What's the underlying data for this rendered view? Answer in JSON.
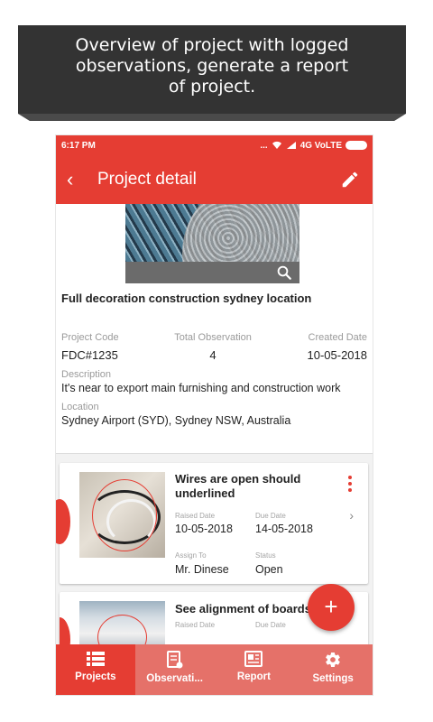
{
  "banner": {
    "line1": "Overview of project with logged",
    "line2": "observations, generate a report",
    "line3": "of project."
  },
  "status_bar": {
    "time": "6:17 PM",
    "indicators": "... ",
    "network": "4G VoLTE"
  },
  "app_bar": {
    "title": "Project detail",
    "back_icon": "chevron-left-icon",
    "edit_icon": "pencil-icon"
  },
  "project": {
    "name": "Full decoration construction sydney location",
    "code_label": "Project Code",
    "code": "FDC#1235",
    "total_label": "Total Observation",
    "total": "4",
    "created_label": "Created Date",
    "created": "10-05-2018",
    "description_label": "Description",
    "description": "It's near to export main furnishing and construction work",
    "location_label": "Location",
    "location": "Sydney Airport (SYD), Sydney NSW, Australia"
  },
  "observations": [
    {
      "title": "Wires are open should underlined",
      "raised_label": "Raised Date",
      "raised": "10-05-2018",
      "due_label": "Due Date",
      "due": "14-05-2018",
      "assign_label": "Assign To",
      "assign": "Mr. Dinese",
      "status_label": "Status",
      "status": "Open"
    },
    {
      "title": "See alignment of boards",
      "raised_label": "Raised Date",
      "due_label": "Due Date"
    }
  ],
  "fab": {
    "label": "+"
  },
  "bottom_nav": [
    {
      "label": "Projects",
      "icon": "list-icon",
      "active": true
    },
    {
      "label": "Observati...",
      "icon": "document-icon",
      "active": false
    },
    {
      "label": "Report",
      "icon": "report-icon",
      "active": false
    },
    {
      "label": "Settings",
      "icon": "gear-icon",
      "active": false
    }
  ],
  "colors": {
    "accent": "#e53d33",
    "nav_inactive": "#e57169",
    "banner_bg": "#333333"
  }
}
